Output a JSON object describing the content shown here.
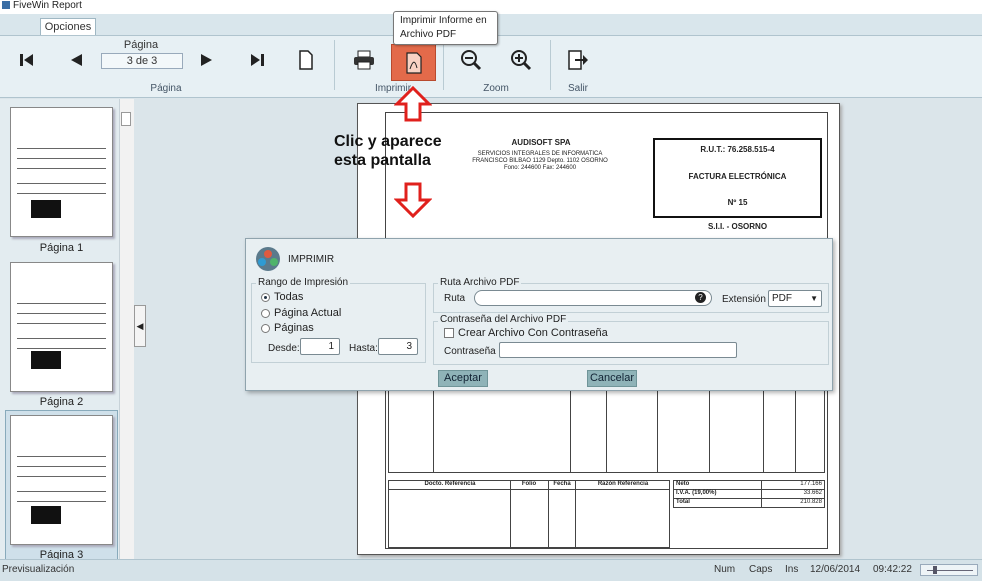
{
  "window": {
    "title": "FiveWin Report"
  },
  "tabs": [
    {
      "label": "Opciones"
    }
  ],
  "ribbon": {
    "pagina_label": "Página",
    "page_counter": "3 de 3",
    "groups": {
      "pagina": "Página",
      "imprimir": "Imprimir",
      "zoom": "Zoom",
      "salir": "Salir"
    }
  },
  "tooltip": {
    "text": "Imprimir Informe en Archivo PDF"
  },
  "annotation": {
    "text": "Clic y aparece esta pantalla"
  },
  "thumbnails": [
    {
      "label": "Página 1"
    },
    {
      "label": "Página 2"
    },
    {
      "label": "Página 3"
    }
  ],
  "invoice": {
    "company": "AUDISOFT SPA",
    "line1": "SERVICIOS INTEGRALES DE INFORMATICA",
    "line2": "FRANCISCO BILBAO 1129 Depto. 1102 OSORNO",
    "line3": "Fono: 244600 Fax: 244600",
    "rut": "R.U.T.: 76.258.515-4",
    "doc_type": "FACTURA ELECTRÓNICA",
    "number": "Nº 15",
    "sii": "S.I.I. - OSORNO",
    "ref_headers": [
      "Docto. Referencia",
      "Folio",
      "Fecha",
      "Razón Referencia"
    ],
    "totals": [
      {
        "label": "Neto",
        "value": "177.166"
      },
      {
        "label": "I.V.A. (19,00%)",
        "value": "33.662"
      },
      {
        "label": "Total",
        "value": "210.828"
      }
    ]
  },
  "dialog": {
    "title": "IMPRIMIR",
    "range_legend": "Rango de Impresión",
    "options": [
      "Todas",
      "Página Actual",
      "Páginas"
    ],
    "selected_option": "Todas",
    "desde_label": "Desde:",
    "desde_value": "1",
    "hasta_label": "Hasta:",
    "hasta_value": "3",
    "ruta_legend": "Ruta Archivo PDF",
    "ruta_label": "Ruta",
    "ruta_value": "",
    "extension_label": "Extensión",
    "extension_value": "PDF",
    "password_legend": "Contraseña del Archivo PDF",
    "create_password_label": "Crear Archivo Con Contraseña",
    "create_password_checked": false,
    "password_label": "Contraseña",
    "password_value": "",
    "accept_label": "Aceptar",
    "cancel_label": "Cancelar"
  },
  "status": {
    "left": "Previsualización",
    "num": "Num",
    "caps": "Caps",
    "ins": "Ins",
    "date": "12/06/2014",
    "time": "09:42:22"
  },
  "colors": {
    "accent_pdf": "#e36a4a",
    "ribbon_bg": "#e7f0f4",
    "arrow_red": "#e0201c"
  }
}
